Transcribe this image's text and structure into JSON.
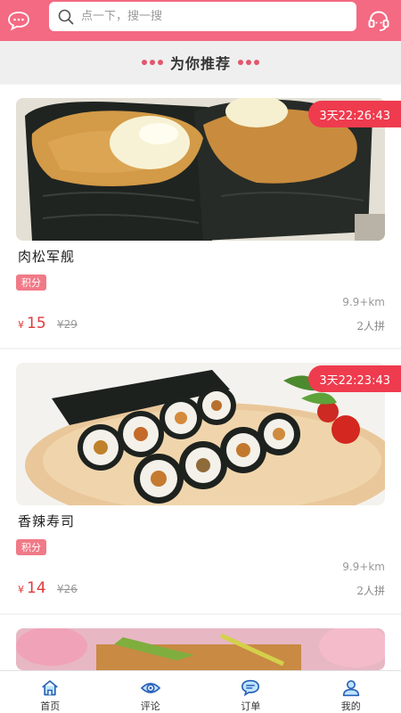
{
  "header": {
    "search_placeholder": "点一下，搜一搜",
    "left_icon": "chat-bubble-icon",
    "right_icon": "headset-icon"
  },
  "section": {
    "title": "为你推荐"
  },
  "products": [
    {
      "name": "肉松军舰",
      "countdown": "3天22:26:43",
      "badge": "积分",
      "distance": "9.9+km",
      "currency": "¥",
      "price": "15",
      "old_price": "¥29",
      "group": "2人拼"
    },
    {
      "name": "香辣寿司",
      "countdown": "3天22:23:43",
      "badge": "积分",
      "distance": "9.9+km",
      "currency": "¥",
      "price": "14",
      "old_price": "¥26",
      "group": "2人拼"
    }
  ],
  "tabs": [
    {
      "label": "首页",
      "icon": "home-icon"
    },
    {
      "label": "评论",
      "icon": "eye-icon"
    },
    {
      "label": "订单",
      "icon": "message-icon"
    },
    {
      "label": "我的",
      "icon": "user-icon"
    }
  ],
  "colors": {
    "brand": "#f36a82",
    "timer": "#ef3b4e",
    "price": "#e03b3b",
    "nav_icon": "#2a63b8"
  }
}
